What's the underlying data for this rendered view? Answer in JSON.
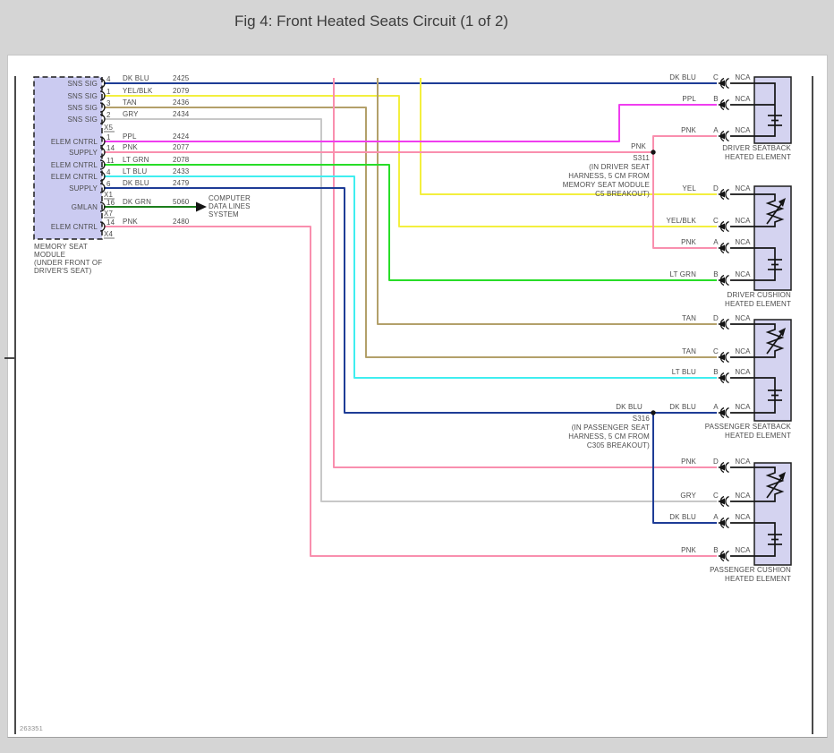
{
  "title": "Fig 4: Front Heated Seats Circuit (1 of 2)",
  "doc_number": "263351",
  "colors": {
    "dk_blu": "#1e3c96",
    "yel": "#f3ef3e",
    "tan": "#b3a06a",
    "gry": "#c8c8c8",
    "ppl": "#ef3def",
    "pnk": "#f98fae",
    "lt_grn": "#28dd28",
    "lt_blu": "#3feef0",
    "dk_grn": "#1b7d1b",
    "module_fill": "#cbcbf1",
    "element_fill": "#d4d3f0"
  },
  "module": {
    "caption": [
      "MEMORY SEAT",
      "MODULE",
      "(UNDER FRONT OF",
      "DRIVER'S SEAT)"
    ],
    "connectors": [
      "X5",
      "X1",
      "X7",
      "X4"
    ],
    "pins": [
      {
        "signal": "SNS SIG",
        "pin": "4",
        "color_name": "DK BLU",
        "circuit": "2425"
      },
      {
        "signal": "SNS SIG",
        "pin": "1",
        "color_name": "YEL/BLK",
        "circuit": "2079"
      },
      {
        "signal": "SNS SIG",
        "pin": "3",
        "color_name": "TAN",
        "circuit": "2436"
      },
      {
        "signal": "SNS SIG",
        "pin": "2",
        "color_name": "GRY",
        "circuit": "2434"
      },
      {
        "signal": "ELEM CNTRL",
        "pin": "1",
        "color_name": "PPL",
        "circuit": "2424"
      },
      {
        "signal": "SUPPLY",
        "pin": "14",
        "color_name": "PNK",
        "circuit": "2077"
      },
      {
        "signal": "ELEM CNTRL",
        "pin": "11",
        "color_name": "LT GRN",
        "circuit": "2078"
      },
      {
        "signal": "ELEM CNTRL",
        "pin": "4",
        "color_name": "LT BLU",
        "circuit": "2433"
      },
      {
        "signal": "SUPPLY",
        "pin": "6",
        "color_name": "DK BLU",
        "circuit": "2479"
      },
      {
        "signal": "GMLAN",
        "pin": "16",
        "color_name": "DK GRN",
        "circuit": "5060"
      },
      {
        "signal": "ELEM CNTRL",
        "pin": "14",
        "color_name": "PNK",
        "circuit": "2480"
      }
    ]
  },
  "computer_note": [
    "COMPUTER",
    "DATA LINES",
    "SYSTEM"
  ],
  "splices": {
    "s311": {
      "id": "S311",
      "wire": "PNK",
      "note": [
        "(IN DRIVER SEAT",
        "HARNESS, 5 CM FROM",
        "MEMORY SEAT MODULE",
        "C5 BREAKOUT)"
      ]
    },
    "s316": {
      "id": "S316",
      "wire": "DK BLU",
      "note": [
        "(IN PASSENGER SEAT",
        "HARNESS, 5 CM FROM",
        "C305 BREAKOUT)"
      ]
    }
  },
  "elements": {
    "driver_seatback": {
      "caption": [
        "DRIVER SEATBACK",
        "HEATED ELEMENT"
      ],
      "pins": [
        {
          "color_name": "DK BLU",
          "pin": "C",
          "term": "NCA"
        },
        {
          "color_name": "PPL",
          "pin": "B",
          "term": "NCA"
        },
        {
          "color_name": "PNK",
          "pin": "A",
          "term": "NCA"
        }
      ]
    },
    "driver_cushion": {
      "caption": [
        "DRIVER CUSHION",
        "HEATED ELEMENT"
      ],
      "pins": [
        {
          "color_name": "YEL",
          "pin": "D",
          "term": "NCA"
        },
        {
          "color_name": "YEL/BLK",
          "pin": "C",
          "term": "NCA"
        },
        {
          "color_name": "PNK",
          "pin": "A",
          "term": "NCA"
        },
        {
          "color_name": "LT GRN",
          "pin": "B",
          "term": "NCA"
        }
      ]
    },
    "passenger_seatback": {
      "caption": [
        "PASSENGER SEATBACK",
        "HEATED ELEMENT"
      ],
      "pins": [
        {
          "color_name": "TAN",
          "pin": "D",
          "term": "NCA"
        },
        {
          "color_name": "TAN",
          "pin": "C",
          "term": "NCA"
        },
        {
          "color_name": "LT BLU",
          "pin": "B",
          "term": "NCA"
        },
        {
          "color_name": "DK BLU",
          "pin": "A",
          "term": "NCA"
        }
      ]
    },
    "passenger_cushion": {
      "caption": [
        "PASSENGER CUSHION",
        "HEATED ELEMENT"
      ],
      "pins": [
        {
          "color_name": "PNK",
          "pin": "D",
          "term": "NCA"
        },
        {
          "color_name": "GRY",
          "pin": "C",
          "term": "NCA"
        },
        {
          "color_name": "DK BLU",
          "pin": "A",
          "term": "NCA"
        },
        {
          "color_name": "PNK",
          "pin": "B",
          "term": "NCA"
        }
      ]
    }
  }
}
